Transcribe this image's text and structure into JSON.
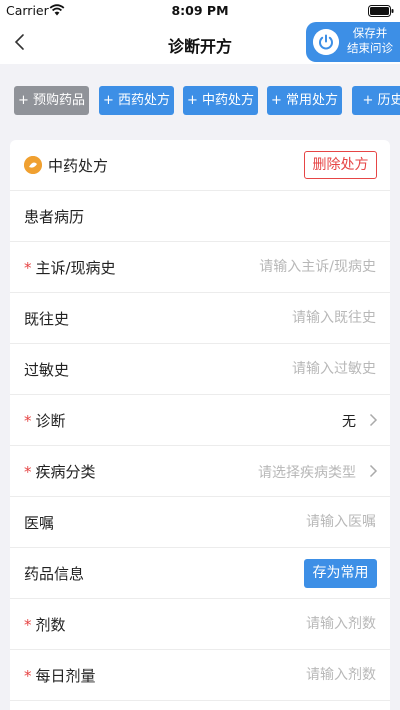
{
  "status_bar": {
    "carrier": "Carrier",
    "time": "8:09 PM",
    "icons": [
      "wifi-icon",
      "battery-icon"
    ]
  },
  "nav": {
    "back_icon": "chevron-left-icon",
    "title": "诊断开方",
    "save_end_line1": "保存并",
    "save_end_line2": "结束问诊",
    "save_end_icon": "power-icon"
  },
  "tags": [
    {
      "label": "+ 预购药品",
      "color": "#909399"
    },
    {
      "label": "+ 西药处方",
      "color": "#3d8fe6"
    },
    {
      "label": "+ 中药处方",
      "color": "#3d8fe6"
    },
    {
      "label": "+ 常用处方",
      "color": "#3d8fe6"
    },
    {
      "label": "+ 历史处",
      "color": "#3d8fe6"
    }
  ],
  "prescription": {
    "icon": "herbal-medicine-icon",
    "title": "中药处方",
    "delete_label": "删除处方",
    "section_title": "患者病历",
    "chief_complaint": {
      "label": "主诉/现病史",
      "required": "*",
      "placeholder": "请输入主诉/现病史",
      "value": ""
    },
    "past_history": {
      "label": "既往史",
      "placeholder": "请输入既往史",
      "value": ""
    },
    "allergy_history": {
      "label": "过敏史",
      "placeholder": "请输入过敏史",
      "value": ""
    },
    "diagnosis": {
      "label": "诊断",
      "required": "*",
      "value": "无"
    },
    "disease_category": {
      "label": "疾病分类",
      "required": "*",
      "placeholder": "请选择疾病类型"
    },
    "medical_advice": {
      "label": "医嘱",
      "placeholder": "请输入医嘱",
      "value": ""
    },
    "drug_info": {
      "label": "药品信息",
      "save_common_label": "存为常用"
    },
    "dose_count": {
      "label": "剂数",
      "required": "*",
      "placeholder": "请输入剂数",
      "value": ""
    },
    "daily_dose": {
      "label": "每日剂量",
      "required": "*",
      "placeholder": "请输入剂数",
      "value": ""
    }
  },
  "colors": {
    "accent": "#3d8fe6",
    "danger": "#e64545",
    "disabled_tag": "#909399",
    "background": "#f2f2f6",
    "placeholder": "#b8b8b8"
  }
}
